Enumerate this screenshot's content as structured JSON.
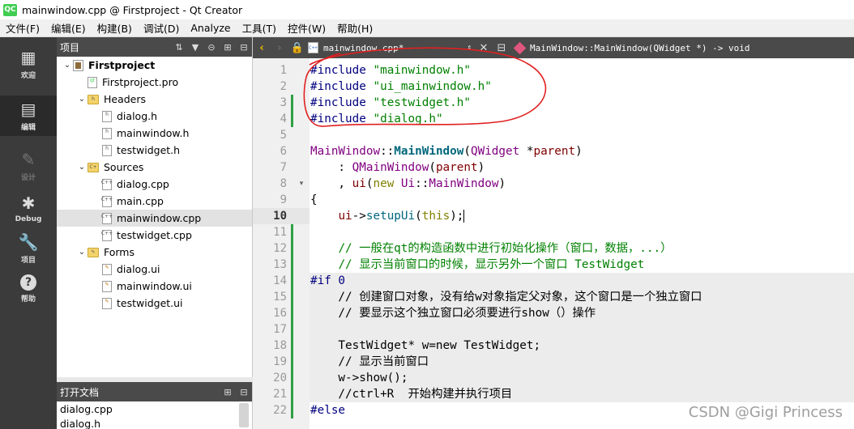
{
  "window": {
    "title": "mainwindow.cpp @ Firstproject - Qt Creator",
    "logo": "QC"
  },
  "menu": [
    "文件(F)",
    "编辑(E)",
    "构建(B)",
    "调试(D)",
    "Analyze",
    "工具(T)",
    "控件(W)",
    "帮助(H)"
  ],
  "modes": [
    {
      "label": "欢迎",
      "icon": "grid-icon"
    },
    {
      "label": "编辑",
      "icon": "edit-doc-icon"
    },
    {
      "label": "设计",
      "icon": "pencil-icon"
    },
    {
      "label": "Debug",
      "icon": "bug-icon"
    },
    {
      "label": "项目",
      "icon": "wrench-icon"
    },
    {
      "label": "帮助",
      "icon": "help-icon"
    }
  ],
  "project_panel": {
    "title": "项目",
    "tree": [
      {
        "label": "Firstproject",
        "level": 0,
        "kind": "project",
        "expanded": true
      },
      {
        "label": "Firstproject.pro",
        "level": 1,
        "kind": "pro"
      },
      {
        "label": "Headers",
        "level": 1,
        "kind": "folder-h",
        "expanded": true
      },
      {
        "label": "dialog.h",
        "level": 2,
        "kind": "h"
      },
      {
        "label": "mainwindow.h",
        "level": 2,
        "kind": "h"
      },
      {
        "label": "testwidget.h",
        "level": 2,
        "kind": "h"
      },
      {
        "label": "Sources",
        "level": 1,
        "kind": "folder-cpp",
        "expanded": true
      },
      {
        "label": "dialog.cpp",
        "level": 2,
        "kind": "cpp"
      },
      {
        "label": "main.cpp",
        "level": 2,
        "kind": "cpp"
      },
      {
        "label": "mainwindow.cpp",
        "level": 2,
        "kind": "cpp",
        "selected": true
      },
      {
        "label": "testwidget.cpp",
        "level": 2,
        "kind": "cpp"
      },
      {
        "label": "Forms",
        "level": 1,
        "kind": "folder-ui",
        "expanded": true
      },
      {
        "label": "dialog.ui",
        "level": 2,
        "kind": "ui"
      },
      {
        "label": "mainwindow.ui",
        "level": 2,
        "kind": "ui"
      },
      {
        "label": "testwidget.ui",
        "level": 2,
        "kind": "ui"
      }
    ]
  },
  "open_docs": {
    "title": "打开文档",
    "items": [
      "dialog.cpp",
      "dialog.h"
    ]
  },
  "editor_toolbar": {
    "file": "mainwindow.cpp*",
    "symbol": "MainWindow::MainWindow(QWidget *) -> void"
  },
  "editor": {
    "current_line": 10,
    "lines": [
      {
        "n": "1",
        "html": "<span class='pp'>#include</span> <span class='str'>\"mainwindow.h\"</span>"
      },
      {
        "n": "2",
        "html": "<span class='pp'>#include</span> <span class='str'>\"ui_mainwindow.h\"</span>"
      },
      {
        "n": "3",
        "html": "<span class='pp'>#include</span> <span class='str'>\"testwidget.h\"</span>",
        "changed": true
      },
      {
        "n": "4",
        "html": "<span class='pp'>#include</span> <span class='str'>\"dialog.h\"</span>",
        "changed": true
      },
      {
        "n": "5",
        "html": ""
      },
      {
        "n": "6",
        "html": "<span class='typ'>MainWindow</span>::<span class='fnb'>MainWindow</span>(<span class='typ'>QWidget</span> *<span class='field'>parent</span>)"
      },
      {
        "n": "7",
        "html": "    : <span class='typ'>QMainWindow</span>(<span class='field'>parent</span>)"
      },
      {
        "n": "8",
        "html": "    , <span class='field'>ui</span>(<span class='kw'>new</span> <span class='typ'>Ui</span>::<span class='typ'>MainWindow</span>)",
        "fold": true
      },
      {
        "n": "9",
        "html": "{"
      },
      {
        "n": "10",
        "html": "    <span class='field'>ui</span>-><span class='fn'>setupUi</span>(<span class='kw'>this</span>);<span class='cursor'></span>",
        "current": true
      },
      {
        "n": "11",
        "html": "",
        "changed": true
      },
      {
        "n": "12",
        "html": "    <span class='cmt'>// 一般在qt的构造函数中进行初始化操作（窗口，数据，...）</span>",
        "changed": true
      },
      {
        "n": "13",
        "html": "    <span class='cmt'>// 显示当前窗口的时候，显示另外一个窗口 TestWidget</span>",
        "changed": true
      },
      {
        "n": "14",
        "html": "<span class='pp'>#if 0</span>",
        "changed": true,
        "disabled": true
      },
      {
        "n": "15",
        "html": "    // 创建窗口对象，没有给w对象指定父对象，这个窗口是一个独立窗口",
        "changed": true,
        "disabled": true
      },
      {
        "n": "16",
        "html": "    // 要显示这个独立窗口必须要进行show（）操作",
        "changed": true,
        "disabled": true
      },
      {
        "n": "17",
        "html": "",
        "changed": true,
        "disabled": true
      },
      {
        "n": "18",
        "html": "    TestWidget* w=new TestWidget;",
        "changed": true,
        "disabled": true
      },
      {
        "n": "19",
        "html": "    // 显示当前窗口",
        "changed": true,
        "disabled": true
      },
      {
        "n": "20",
        "html": "    w->show();",
        "changed": true,
        "disabled": true
      },
      {
        "n": "21",
        "html": "    //ctrl+R  开始构建并执行项目",
        "changed": true,
        "disabled": true
      },
      {
        "n": "22",
        "html": "<span class='pp'>#else</span>",
        "changed": true
      }
    ]
  },
  "watermark": "CSDN @Gigi Princess"
}
